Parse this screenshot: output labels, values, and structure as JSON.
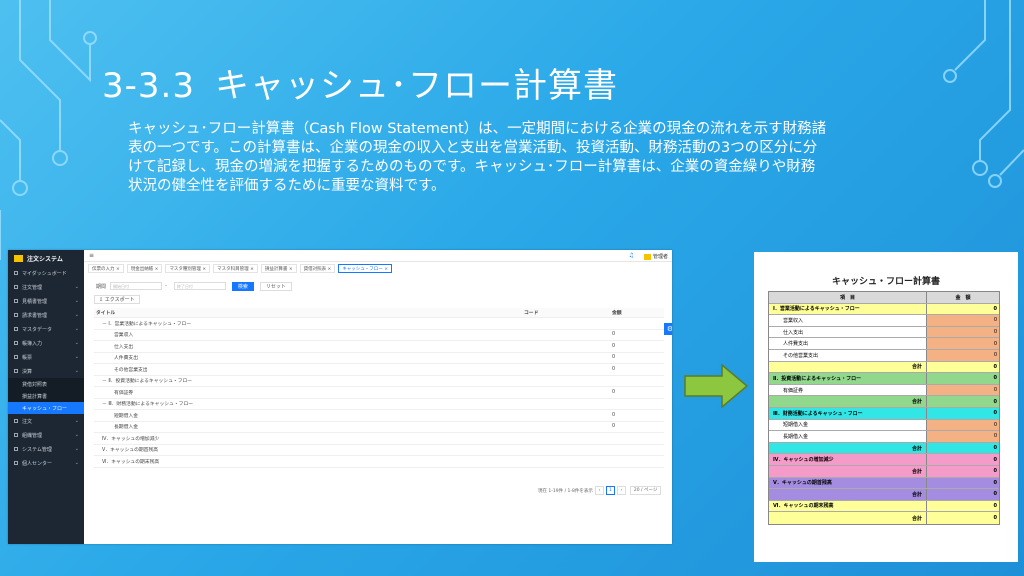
{
  "slide": {
    "number": "3-3.3",
    "title": "キャッシュ･フロー計算書",
    "description": "キャッシュ･フロー計算書（Cash Flow Statement）は、一定期間における企業の現金の流れを示す財務諸表の一つです。この計算書は、企業の現金の収入と支出を営業活動、投資活動、財務活動の3つの区分に分けて記録し、現金の増減を把握するためのものです。キャッシュ･フロー計算書は、企業の資金繰りや財務状況の健全性を評価するために重要な資料です。"
  },
  "app": {
    "name": "注文システム",
    "user": "管理者",
    "sidebar": [
      {
        "label": "マイダッシュボード"
      },
      {
        "label": "注文管理"
      },
      {
        "label": "見積書管理"
      },
      {
        "label": "請求書管理"
      },
      {
        "label": "マスタデータ"
      },
      {
        "label": "帳簿入力"
      },
      {
        "label": "帳票"
      },
      {
        "label": "決算"
      },
      {
        "label": "注文"
      },
      {
        "label": "組織管理"
      },
      {
        "label": "システム管理"
      },
      {
        "label": "個人センター"
      }
    ],
    "sidebar_sub": [
      "貸借対照表",
      "損益計算書",
      "キャッシュ・フロー"
    ],
    "tabs": [
      "伝票の入力",
      "現金出納帳",
      "マスタ種別管理",
      "マスタ科目管理",
      "損益計算書",
      "貸借対照表",
      "キャッシュ・フロー"
    ],
    "filter": {
      "label": "期間",
      "start_placeholder": "開始日付",
      "sep": "-",
      "end_placeholder": "終了日付",
      "search": "検索",
      "reset": "リセット"
    },
    "export": "エクスポート",
    "columns": [
      "タイトル",
      "コード",
      "金額"
    ],
    "rows": [
      {
        "title": "－ Ⅰ．営業活動によるキャッシュ・フロー",
        "amount": ""
      },
      {
        "title": "営業収入",
        "amount": "0"
      },
      {
        "title": "仕入支出",
        "amount": "0"
      },
      {
        "title": "人件費支出",
        "amount": "0"
      },
      {
        "title": "その他営業支出",
        "amount": "0"
      },
      {
        "title": "－ Ⅱ．投資活動によるキャッシュ・フロー",
        "amount": ""
      },
      {
        "title": "有価証券",
        "amount": "0"
      },
      {
        "title": "－ Ⅲ．財務活動によるキャッシュ・フロー",
        "amount": ""
      },
      {
        "title": "短期借入金",
        "amount": "0"
      },
      {
        "title": "長期借入金",
        "amount": "0"
      },
      {
        "title": "Ⅳ．キャッシュの増加減少",
        "amount": ""
      },
      {
        "title": "Ⅴ．キャッシュの期首残高",
        "amount": ""
      },
      {
        "title": "Ⅵ．キャッシュの期末残高",
        "amount": ""
      }
    ],
    "pager": {
      "summary": "現在 1-19件 / 1-8件を表示",
      "page": "1",
      "size": "20 / ページ"
    }
  },
  "report": {
    "title": "キャッシュ・フロー計算書",
    "header": [
      "項　目",
      "金　額"
    ],
    "rows": [
      {
        "label": "Ⅰ．営業活動によるキャッシュ・フロー",
        "value": "0",
        "kind": "sec",
        "bg": "#ffff99",
        "vbg": "#ffff99"
      },
      {
        "label": "営業収入",
        "value": "0",
        "kind": "sub",
        "bg": "#ffffff",
        "vbg": "#f4b183"
      },
      {
        "label": "仕入支出",
        "value": "0",
        "kind": "sub",
        "bg": "#ffffff",
        "vbg": "#f4b183"
      },
      {
        "label": "人件費支出",
        "value": "0",
        "kind": "sub",
        "bg": "#ffffff",
        "vbg": "#f4b183"
      },
      {
        "label": "その他営業支出",
        "value": "0",
        "kind": "sub",
        "bg": "#ffffff",
        "vbg": "#f4b183"
      },
      {
        "label": "合計",
        "value": "0",
        "kind": "tot",
        "bg": "#ffff99",
        "vbg": "#ffff99"
      },
      {
        "label": "Ⅱ．投資活動によるキャッシュ・フロー",
        "value": "0",
        "kind": "sec",
        "bg": "#92d88c",
        "vbg": "#92d88c"
      },
      {
        "label": "有価証券",
        "value": "0",
        "kind": "sub",
        "bg": "#ffffff",
        "vbg": "#f4b183"
      },
      {
        "label": "合計",
        "value": "0",
        "kind": "tot",
        "bg": "#92d88c",
        "vbg": "#92d88c"
      },
      {
        "label": "Ⅲ．財務活動によるキャッシュ・フロー",
        "value": "0",
        "kind": "sec",
        "bg": "#33e6e6",
        "vbg": "#33e6e6"
      },
      {
        "label": "短期借入金",
        "value": "0",
        "kind": "sub",
        "bg": "#ffffff",
        "vbg": "#f4b183"
      },
      {
        "label": "長期借入金",
        "value": "0",
        "kind": "sub",
        "bg": "#ffffff",
        "vbg": "#f4b183"
      },
      {
        "label": "合計",
        "value": "0",
        "kind": "tot",
        "bg": "#33e6e6",
        "vbg": "#33e6e6"
      },
      {
        "label": "Ⅳ．キャッシュの増加減少",
        "value": "0",
        "kind": "sec",
        "bg": "#f59bc9",
        "vbg": "#f59bc9"
      },
      {
        "label": "合計",
        "value": "0",
        "kind": "tot",
        "bg": "#f59bc9",
        "vbg": "#f59bc9"
      },
      {
        "label": "Ⅴ．キャッシュの期首残高",
        "value": "0",
        "kind": "sec",
        "bg": "#a48ce0",
        "vbg": "#a48ce0"
      },
      {
        "label": "合計",
        "value": "0",
        "kind": "tot",
        "bg": "#a48ce0",
        "vbg": "#a48ce0"
      },
      {
        "label": "Ⅵ．キャッシュの期末残高",
        "value": "0",
        "kind": "sec",
        "bg": "#ffff99",
        "vbg": "#ffff99"
      },
      {
        "label": "合計",
        "value": "0",
        "kind": "tot",
        "bg": "#ffff99",
        "vbg": "#ffff99"
      }
    ]
  },
  "colors": {
    "slide_bg": "#2aa8e8",
    "accent": "#1677ff",
    "sidebar_bg": "#1d2733",
    "arrow": "#8dc63f"
  }
}
